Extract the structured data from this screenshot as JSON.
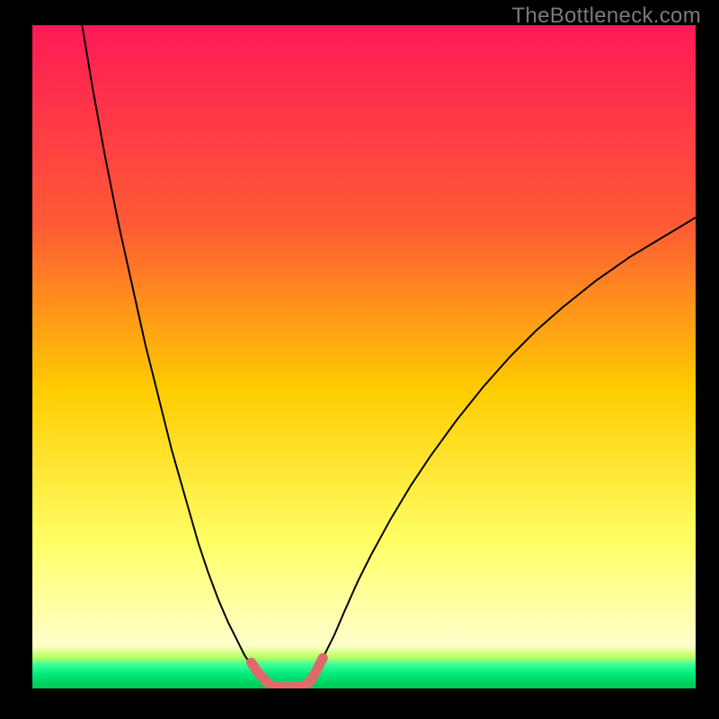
{
  "watermark": "TheBottleneck.com",
  "chart_data": {
    "type": "line",
    "title": "",
    "xlabel": "",
    "ylabel": "",
    "xlim": [
      0,
      100
    ],
    "ylim": [
      0,
      100
    ],
    "background_gradient": {
      "stops": [
        {
          "offset": 0.0,
          "color": "#ff1a56"
        },
        {
          "offset": 0.3,
          "color": "#ff5a35"
        },
        {
          "offset": 0.55,
          "color": "#ffcc00"
        },
        {
          "offset": 0.78,
          "color": "#ffff66"
        },
        {
          "offset": 0.935,
          "color": "#ffffcc"
        },
        {
          "offset": 0.952,
          "color": "#c1ff66"
        },
        {
          "offset": 0.965,
          "color": "#33ff99"
        },
        {
          "offset": 0.98,
          "color": "#00e676"
        },
        {
          "offset": 1.0,
          "color": "#00c853"
        }
      ]
    },
    "series": [
      {
        "name": "curve-left",
        "stroke": "#000000",
        "stroke_width": 2.0,
        "x": [
          7.5,
          9,
          11,
          13,
          15,
          17,
          19,
          21,
          23,
          25,
          26.5,
          28,
          29.5,
          31,
          32,
          33,
          33.8,
          34.5,
          35,
          35.5,
          36
        ],
        "y": [
          100,
          91,
          80,
          70,
          61,
          52,
          44,
          36,
          29,
          22,
          17.5,
          13.5,
          10,
          7,
          5,
          3.5,
          2.4,
          1.6,
          1.0,
          0.6,
          0.3
        ]
      },
      {
        "name": "curve-right",
        "stroke": "#000000",
        "stroke_width": 2.0,
        "x": [
          41,
          42,
          43,
          44,
          45.5,
          47,
          49,
          51,
          54,
          57,
          60,
          64,
          68,
          72,
          76,
          80,
          85,
          90,
          95,
          100
        ],
        "y": [
          0.3,
          1.2,
          3.0,
          5.0,
          8.0,
          11.5,
          16,
          20,
          25.5,
          30.5,
          35,
          40.5,
          45.5,
          50,
          54,
          57.5,
          61.5,
          65,
          68,
          71
        ]
      },
      {
        "name": "highlight-floor",
        "stroke": "#e06a6a",
        "stroke_width": 11,
        "linecap": "round",
        "x": [
          36.2,
          37,
          38,
          39,
          40,
          41
        ],
        "y": [
          0.3,
          0.2,
          0.2,
          0.2,
          0.25,
          0.3
        ]
      },
      {
        "name": "highlight-left",
        "stroke": "#e06a6a",
        "stroke_width": 11,
        "linecap": "round",
        "x": [
          33.0,
          33.8,
          34.5,
          35.0,
          35.5,
          36.0,
          36.2
        ],
        "y": [
          3.9,
          2.7,
          1.9,
          1.3,
          0.85,
          0.5,
          0.3
        ]
      },
      {
        "name": "highlight-right",
        "stroke": "#e06a6a",
        "stroke_width": 11,
        "linecap": "round",
        "x": [
          41,
          42,
          43,
          43.8
        ],
        "y": [
          0.3,
          1.2,
          3.0,
          4.6
        ]
      }
    ]
  }
}
